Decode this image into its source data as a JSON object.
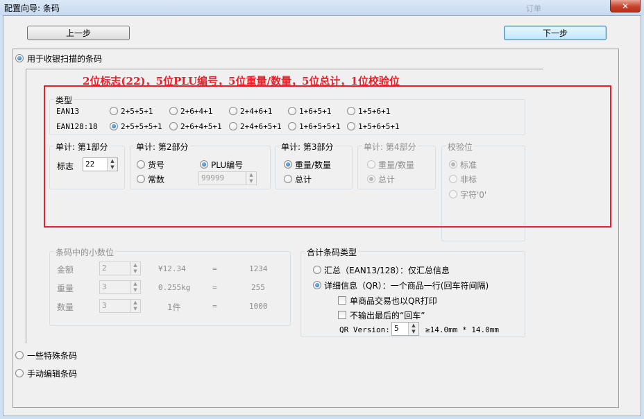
{
  "window": {
    "title": "配置向导: 条码",
    "ghost_text": "订单",
    "close_label": "✕"
  },
  "nav": {
    "prev_label": "上一步",
    "next_label": "下一步"
  },
  "modes": {
    "retail_label": "用于收银扫描的条码",
    "special_label": "一些特殊条码",
    "manual_label": "手动编辑条码",
    "selected": "retail"
  },
  "annotation": "2位标志(22)，5位PLU编号，5位重量/数量，5位总计，1位校验位",
  "type_group": {
    "title": "类型",
    "rows": [
      {
        "name": "EAN13",
        "options": [
          "2+5+5+1",
          "2+6+4+1",
          "2+4+6+1",
          "1+6+5+1",
          "1+5+6+1"
        ],
        "selected": -1
      },
      {
        "name": "EAN128:18",
        "options": [
          "2+5+5+5+1",
          "2+6+4+5+1",
          "2+4+6+5+1",
          "1+6+5+5+1",
          "1+5+6+5+1"
        ],
        "selected": 0
      }
    ]
  },
  "part1": {
    "title": "单计: 第1部分",
    "flag_label": "标志",
    "flag_value": "22"
  },
  "part2": {
    "title": "单计: 第2部分",
    "options": [
      "货号",
      "PLU编号",
      "常数"
    ],
    "selected": "PLU编号",
    "const_value": "99999"
  },
  "part3": {
    "title": "单计: 第3部分",
    "options": [
      "重量/数量",
      "总计"
    ],
    "selected": "重量/数量"
  },
  "part4": {
    "title": "单计: 第4部分",
    "options": [
      "重量/数量",
      "总计"
    ],
    "selected": "总计"
  },
  "check": {
    "title": "校验位",
    "options": [
      "标准",
      "非标",
      "字符'0'"
    ],
    "selected": "标准"
  },
  "decimals": {
    "title": "条码中的小数位",
    "rows": [
      {
        "label": "金额",
        "digits": "2",
        "example": "¥12.34",
        "eq": "=",
        "raw": "1234"
      },
      {
        "label": "重量",
        "digits": "3",
        "example": "0.255kg",
        "eq": "=",
        "raw": "255"
      },
      {
        "label": "数量",
        "digits": "3",
        "example": "1件",
        "eq": "=",
        "raw": "1000"
      }
    ]
  },
  "total_type": {
    "title": "合计条码类型",
    "summary_label": "汇总（EAN13/128）：仅汇总信息",
    "detail_label": "详细信息（QR）：一个商品一行(回车符间隔)",
    "selected": "detail",
    "single_qr_label": "单商品交易也以QR打印",
    "no_last_cr_label": "不输出最后的“回车”",
    "qr_version_label": "QR Version:",
    "qr_version_value": "5",
    "qr_size_text": "≥14.0mm * 14.0mm"
  },
  "colors": {
    "annotation_red": "#e8202a",
    "radio_selected": "#1b5fa3"
  }
}
